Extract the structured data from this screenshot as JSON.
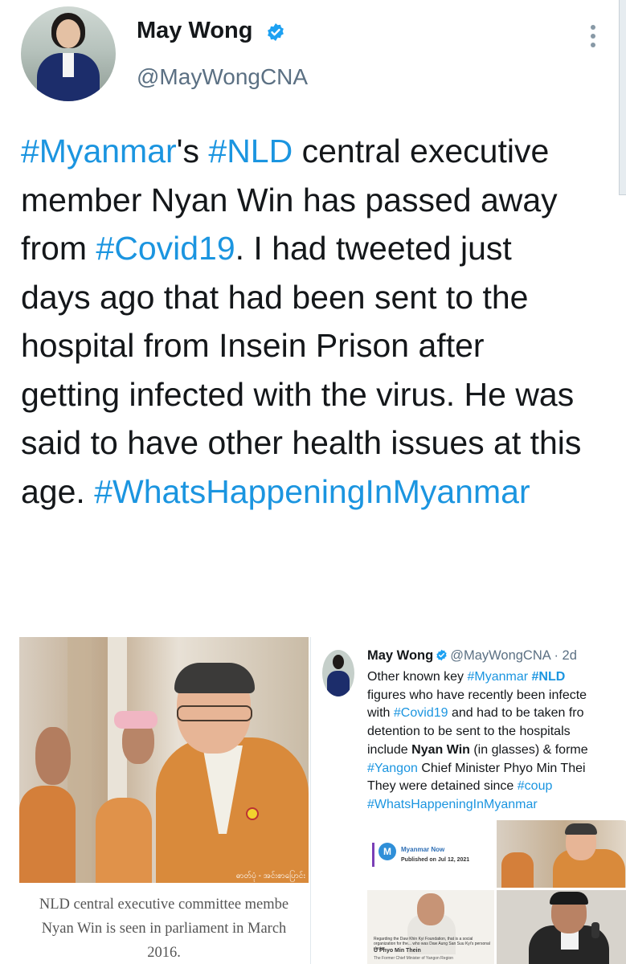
{
  "tweet": {
    "author": {
      "name": "May Wong",
      "handle": "@MayWongCNA",
      "verified": true
    },
    "icons": {
      "verified": "verified-badge-icon",
      "more": "more-vertical-icon"
    },
    "accent_color": "#1b95e0",
    "text": [
      {
        "t": "#Myanmar",
        "tag": true
      },
      {
        "t": "'s ",
        "tag": false
      },
      {
        "t": "#NLD",
        "tag": true
      },
      {
        "t": " central executive member Nyan Win has passed away from ",
        "tag": false
      },
      {
        "t": "#Covid19",
        "tag": true
      },
      {
        "t": ". I had tweeted just days ago that had been sent to the hospital from Insein Prison after getting infected with the virus. He was said to have other health issues at this age. ",
        "tag": false
      },
      {
        "t": "#WhatsHappeningInMyanmar",
        "tag": true
      }
    ]
  },
  "media_left": {
    "photo_credit": "ဓာတ်ပုံ - အင်းစာပြောင်း",
    "caption": "NLD central executive committee membe\nNyan Win is seen in parliament in March\n2016."
  },
  "quoted_tweet": {
    "name": "May Wong",
    "handle": "@MayWongCNA",
    "time": "· 2d",
    "body": [
      {
        "t": "Other known key ",
        "s": "n"
      },
      {
        "t": "#Myanmar",
        "s": "tag"
      },
      {
        "t": " ",
        "s": "n"
      },
      {
        "t": "#NLD",
        "s": "tagb"
      },
      {
        "t": "\nfigures who have recently been infecte\nwith ",
        "s": "n"
      },
      {
        "t": "#Covid19",
        "s": "tag"
      },
      {
        "t": " and had to be taken fro\ndetention to be sent to the hospitals\ninclude ",
        "s": "n"
      },
      {
        "t": "Nyan Win",
        "s": "b"
      },
      {
        "t": " (in glasses) & forme\n",
        "s": "n"
      },
      {
        "t": "#Yangon",
        "s": "tag"
      },
      {
        "t": " Chief Minister Phyo Min Thei\nThey were detained since ",
        "s": "n"
      },
      {
        "t": "#coup",
        "s": "tag"
      },
      {
        "t": "\n",
        "s": "n"
      },
      {
        "t": "#WhatsHappeningInMyanmar",
        "s": "tag"
      }
    ],
    "article": {
      "logo": "M",
      "title": "Myanmar Now",
      "date": "Published on Jul 12, 2021"
    },
    "thumb3": {
      "text": "Regarding the Daw Khin Kyi Foundation, that is a social organization for the... who was Daw Aung San Suu Kyi's personal doctor",
      "name": "U Phyo Min Thein",
      "subtitle": "The Former Chief Minister of Yangon Region"
    }
  }
}
